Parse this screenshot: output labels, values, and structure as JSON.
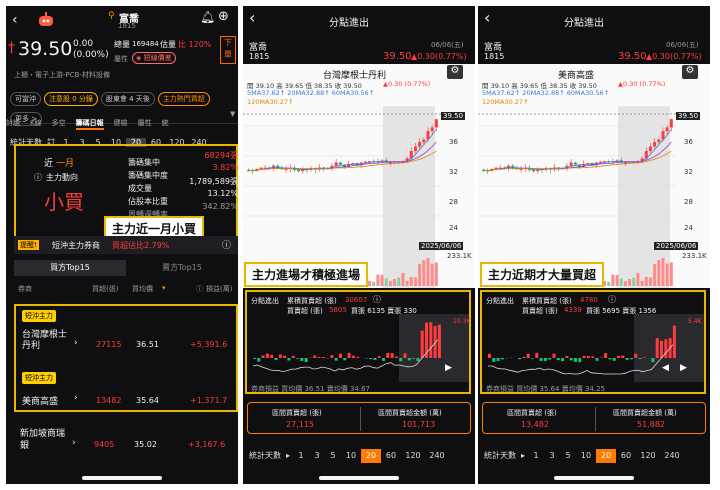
{
  "panel1": {
    "stock_name": "富喬",
    "stock_code": "1815",
    "price": "39.50",
    "change": "0.00",
    "change_pct": "(0.00%)",
    "volume_label": "總量",
    "volume_value": "169484",
    "estimate_label": "估量",
    "estimate_pct": "比 120%",
    "side_label_1": "下",
    "side_label_2": "單",
    "tag_label": "屬性",
    "tag_value": "短線價差",
    "industry": "上櫃・電子上游-PCB-材料設備",
    "chips": [
      "可當沖",
      "注意股 0 分鐘",
      "股東會 4 天後",
      "主力熱門買超",
      "更多 >"
    ],
    "tabs": [
      "討論",
      "K線",
      "多空",
      "籌碼日報",
      "健檢",
      "屬性",
      "統"
    ],
    "days_label": "統計天數",
    "days_sublabel": "訂",
    "days": [
      "1",
      "3",
      "5",
      "10",
      "20",
      "60",
      "120",
      "240"
    ],
    "days_selected": "20",
    "period_label": "近",
    "period_value": "一月",
    "trend_label": "主力動向",
    "trend_value": "小買",
    "metrics": [
      {
        "label": "籌碼集中",
        "value": "68294張"
      },
      {
        "label": "籌碼集中度",
        "value": "3.82%"
      },
      {
        "label": "成交量",
        "value": "1,789,589張"
      },
      {
        "label": "佔股本比重",
        "value": "13.12%"
      },
      {
        "label": "周轉週轉率",
        "value": "342.82%"
      }
    ],
    "callout": "主力近一月小買",
    "reminder_label": "提醒!",
    "reminder_text": "短沖主力券商",
    "reminder_pct": "買超佔比2.79%",
    "buy_tab": "買方Top15",
    "sell_tab": "賣方Top15",
    "table_headers": [
      "券商",
      "買超(張)",
      "買均價",
      "損益(萬)"
    ],
    "brokers": [
      {
        "tag": "短沖主力",
        "name": "台灣摩根士丹利",
        "buy": "27115",
        "avg": "36.51",
        "pnl": "+5,391.6"
      },
      {
        "tag": "短沖主力",
        "name": "美商高盛",
        "buy": "13482",
        "avg": "35.64",
        "pnl": "+1,371.7"
      },
      {
        "tag": "",
        "name": "新加坡商瑞銀",
        "buy": "9405",
        "avg": "35.02",
        "pnl": "+3,167.6"
      }
    ]
  },
  "panel2": {
    "nav_title": "分點進出",
    "stock_name": "富喬",
    "stock_code": "1815",
    "date": "06/06(五)",
    "price": "39.50",
    "change": "▲0.30(0.77%)",
    "chart_title": "台灣摩根士丹利",
    "ohlc": "開 39.10  高 39.65  低 38.35  收 39.50",
    "chg": "▲0.30 (0.77%)",
    "ma_line": "5MA37.62↑  20MA32.88↑  60MA30.56↑",
    "ma_line2": "120MA30.27↑",
    "price_tag": "39.50",
    "y_ticks": [
      "39.50",
      "36",
      "32",
      "28",
      "24"
    ],
    "date_tag": "2025/06/06",
    "vol_tag": "233.1K",
    "callout": "主力進場才積極進場",
    "sub_title": "分點進出",
    "sub_line1": "累積買賣超 (張)",
    "sub_line1_val": "30607",
    "sub_line2a": "買賣超 (張)",
    "sub_line2a_val": "5805",
    "sub_line2b": "買張 6135  賣張 330",
    "bar_tag": "10.3K",
    "bottom_line": "券商損益   買均價 36.51  賣均價 34.67",
    "stats": [
      {
        "label": "區間買賣超 (張)",
        "value": "27,115"
      },
      {
        "label": "區間買賣超金額 (萬)",
        "value": "101,713"
      }
    ],
    "days_label": "統計天數",
    "days": [
      "1",
      "3",
      "5",
      "10",
      "20",
      "60",
      "120",
      "240"
    ],
    "days_selected": "20"
  },
  "panel3": {
    "nav_title": "分點進出",
    "stock_name": "富喬",
    "stock_code": "1815",
    "date": "06/06(五)",
    "price": "39.50",
    "change": "▲0.30(0.77%)",
    "chart_title": "美商高盛",
    "ohlc": "開 39.10  高 39.65  低 38.35  收 39.50",
    "chg": "▲0.30 (0.77%)",
    "ma_line": "5MA37.62↑  20MA32.88↑  60MA30.56↑",
    "ma_line2": "120MA30.27↑",
    "price_tag": "39.50",
    "y_ticks": [
      "39.50",
      "36",
      "32",
      "28",
      "24"
    ],
    "date_tag": "2025/06/06",
    "vol_tag": "233.1K",
    "callout": "主力近期才大量買超",
    "sub_title": "分點進出",
    "sub_line1": "累積買賣超 (張)",
    "sub_line1_val": "4780",
    "sub_line2a": "買賣超 (張)",
    "sub_line2a_val": "4339",
    "sub_line2b": "買張 5695  賣張 1356",
    "bar_tag": "5.4K",
    "bottom_line": "券商損益   買均價 35.64  賣均價 34.25",
    "stats": [
      {
        "label": "區間買賣超 (張)",
        "value": "13,482"
      },
      {
        "label": "區間買賣超金額 (萬)",
        "value": "51,882"
      }
    ],
    "days_label": "統計天數",
    "days": [
      "1",
      "3",
      "5",
      "10",
      "20",
      "60",
      "120",
      "240"
    ],
    "days_selected": "20"
  },
  "colors": {
    "up": "#ff3b3b",
    "down": "#19c36b",
    "accent": "#ff7a00",
    "highlight": "#e8b800"
  }
}
